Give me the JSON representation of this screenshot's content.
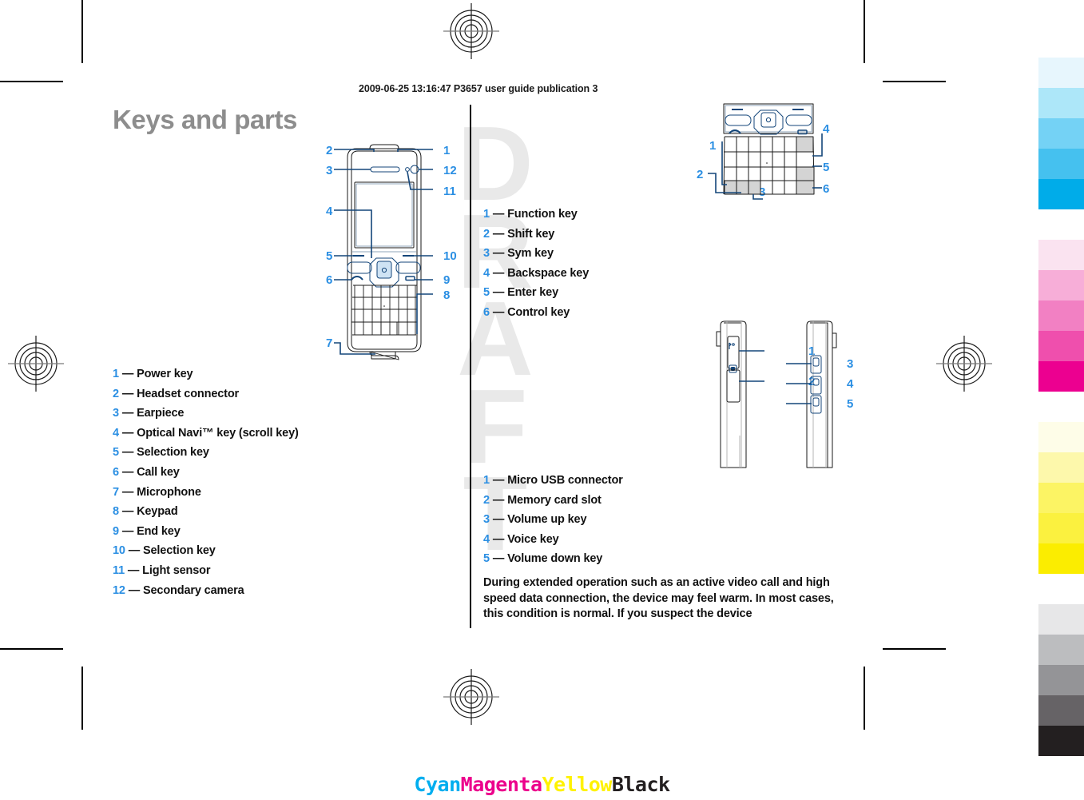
{
  "page": {
    "header_line": "2009-06-25 13:16:47 P3657 user guide publication 3",
    "title": "Keys and parts",
    "watermark": "DRAFT"
  },
  "front_view": {
    "callouts": [
      "2",
      "3",
      "4",
      "5",
      "6",
      "7",
      "1",
      "12",
      "11",
      "10",
      "9",
      "8"
    ]
  },
  "keyboard_view": {
    "callouts": [
      "1",
      "2",
      "3",
      "4",
      "5",
      "6"
    ]
  },
  "side_view": {
    "callouts": [
      "1",
      "2",
      "3",
      "4",
      "5"
    ]
  },
  "front_legend": {
    "items": [
      {
        "num": "1",
        "dash": "—",
        "label": "Power key"
      },
      {
        "num": "2",
        "dash": "—",
        "label": "Headset connector"
      },
      {
        "num": "3",
        "dash": "—",
        "label": "Earpiece"
      },
      {
        "num": "4",
        "dash": "—",
        "label": "Optical Navi™ key (scroll key)"
      },
      {
        "num": "5",
        "dash": "—",
        "label": "Selection key"
      },
      {
        "num": "6",
        "dash": "—",
        "label": "Call key"
      },
      {
        "num": "7",
        "dash": "—",
        "label": "Microphone"
      },
      {
        "num": "8",
        "dash": "—",
        "label": "Keypad"
      },
      {
        "num": "9",
        "dash": "—",
        "label": "End key"
      },
      {
        "num": "10",
        "dash": "—",
        "label": "Selection key"
      },
      {
        "num": "11",
        "dash": "—",
        "label": "Light sensor"
      },
      {
        "num": "12",
        "dash": "—",
        "label": "Secondary camera"
      }
    ]
  },
  "keyboard_legend": {
    "items": [
      {
        "num": "1",
        "dash": "—",
        "label": "Function key"
      },
      {
        "num": "2",
        "dash": "—",
        "label": "Shift key"
      },
      {
        "num": "3",
        "dash": "—",
        "label": "Sym key"
      },
      {
        "num": "4",
        "dash": "—",
        "label": "Backspace key"
      },
      {
        "num": "5",
        "dash": "—",
        "label": "Enter key"
      },
      {
        "num": "6",
        "dash": "—",
        "label": "Control key"
      }
    ]
  },
  "side_legend": {
    "items": [
      {
        "num": "1",
        "dash": "—",
        "label": "Micro USB connector"
      },
      {
        "num": "2",
        "dash": "—",
        "label": "Memory card slot"
      },
      {
        "num": "3",
        "dash": "—",
        "label": "Volume up key"
      },
      {
        "num": "4",
        "dash": "—",
        "label": "Voice key"
      },
      {
        "num": "5",
        "dash": "—",
        "label": "Volume down key"
      }
    ]
  },
  "body_paragraph": {
    "text": "During extended operation such as an active video call and high speed data connection, the device may feel warm. In most cases, this condition is normal. If you suspect the device"
  },
  "color_bar": {
    "groups": [
      {
        "name": "cyan",
        "swatches": [
          "#e7f6fd",
          "#ade7f9",
          "#74d2f5",
          "#45c1ef",
          "#00ace9"
        ]
      },
      {
        "name": "magenta",
        "swatches": [
          "#fae3f0",
          "#f7aed8",
          "#f280c3",
          "#ef4fad",
          "#ec0090"
        ]
      },
      {
        "name": "yellow",
        "swatches": [
          "#fefde8",
          "#fdf8ab",
          "#fcf464",
          "#fbf13f",
          "#fbed00"
        ]
      },
      {
        "name": "black",
        "swatches": [
          "#e7e7e8",
          "#bcbdbf",
          "#949497",
          "#666366",
          "#231f20"
        ]
      }
    ]
  },
  "cmyk_caption": {
    "cyan": "Cyan",
    "magenta": "Magenta",
    "yellow": "Yellow",
    "black": "Black",
    "colors": {
      "cyan": "#00aeef",
      "magenta": "#ec008c",
      "yellow": "#fff200",
      "black": "#231f20"
    }
  }
}
